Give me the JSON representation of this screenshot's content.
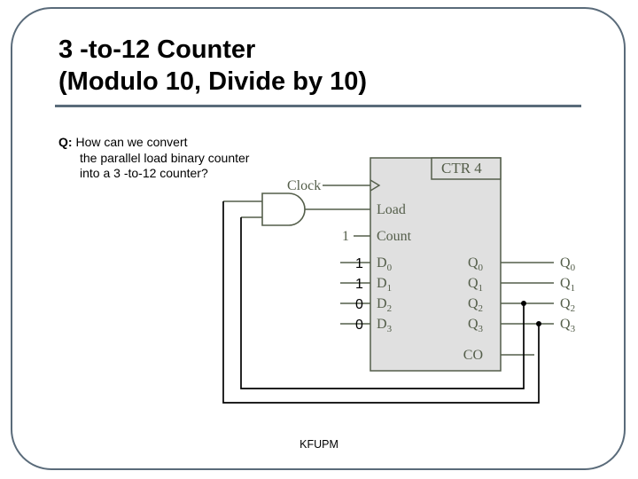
{
  "title": {
    "line1": "3 -to-12 Counter",
    "line2": "(Modulo 10, Divide by 10)"
  },
  "question": {
    "prefix": "Q: ",
    "body": "How can we convert the parallel load binary counter into a 3 -to-12 counter?"
  },
  "block": {
    "header": "CTR 4",
    "inputs": {
      "clock": "Clock",
      "load": "Load",
      "count": "Count",
      "d0": "D",
      "d0s": "0",
      "d1": "D",
      "d1s": "1",
      "d2": "D",
      "d2s": "2",
      "d3": "D",
      "d3s": "3"
    },
    "outputs": {
      "q0": "Q",
      "q0s": "0",
      "q1": "Q",
      "q1s": "1",
      "q2": "Q",
      "q2s": "2",
      "q3": "Q",
      "q3s": "3",
      "co": "CO"
    },
    "count_tie": "1",
    "d_values": [
      "1",
      "1",
      "0",
      "0"
    ]
  },
  "feedback_inputs": [
    "Q2",
    "Q3"
  ],
  "footer": "KFUPM"
}
